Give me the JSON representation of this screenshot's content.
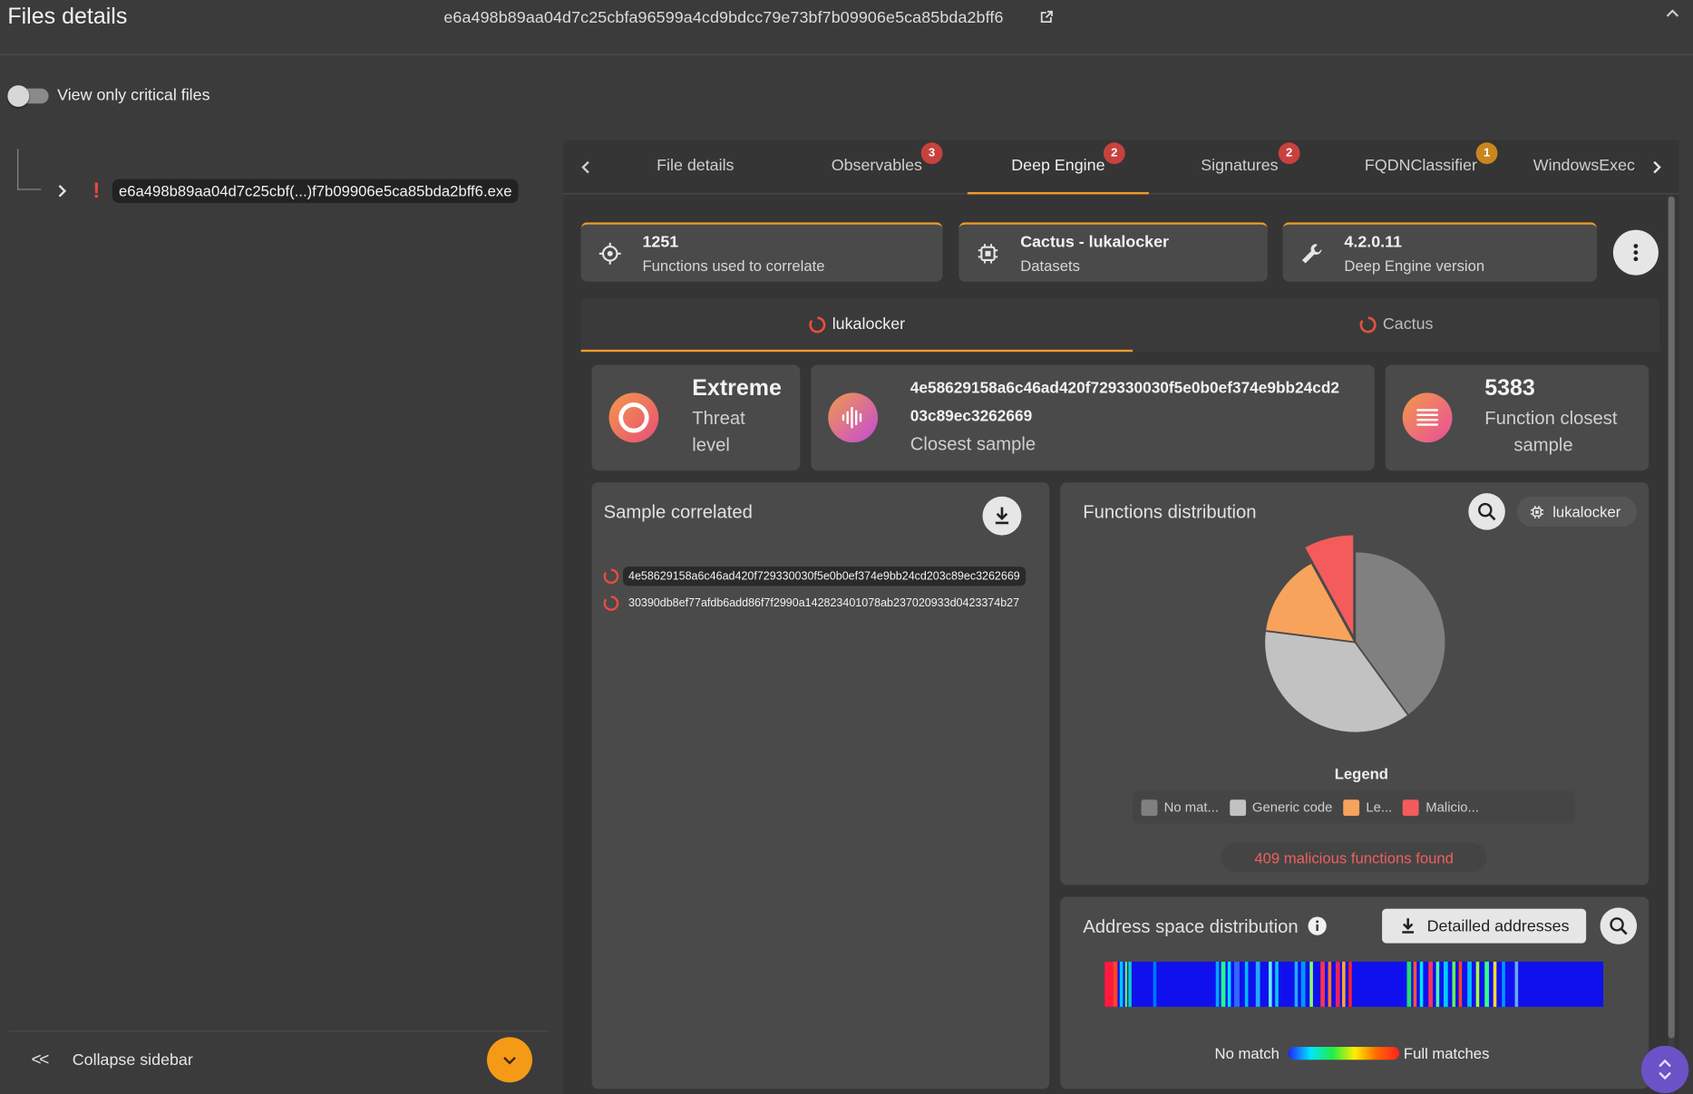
{
  "header": {
    "title": "Files details",
    "file_hash": "e6a498b89aa04d7c25cbfa96599a4cd9bdcc79e73bf7b09906e5ca85bda2bff6"
  },
  "sidebar": {
    "toggle_label": "View only critical files",
    "toggle_on": false,
    "tree_file": "e6a498b89aa04d7c25cbf(...)f7b09906e5ca85bda2bff6.exe",
    "collapse_icon": "<<",
    "collapse_label": "Collapse sidebar"
  },
  "tabs": [
    {
      "label": "File details",
      "badge": ""
    },
    {
      "label": "Observables",
      "badge": "3"
    },
    {
      "label": "Deep Engine",
      "badge": "2",
      "active": true
    },
    {
      "label": "Signatures",
      "badge": "2"
    },
    {
      "label": "FQDNClassifier",
      "badge": "1"
    },
    {
      "label": "WindowsExec",
      "badge": ""
    }
  ],
  "info_cards": [
    {
      "icon": "crosshair-icon",
      "value": "1251",
      "label": "Functions used to correlate"
    },
    {
      "icon": "chip-icon",
      "value": "Cactus - lukalocker",
      "label": "Datasets"
    },
    {
      "icon": "wrench-icon",
      "value": "4.2.0.11",
      "label": "Deep Engine version"
    }
  ],
  "subtabs": [
    {
      "label": "lukalocker",
      "active": true
    },
    {
      "label": "Cactus",
      "active": false
    }
  ],
  "stats": {
    "threat": {
      "value": "Extreme",
      "label_line1": "Threat",
      "label_line2": "level"
    },
    "closest": {
      "line1": "4e58629158a6c46ad420f729330030f5e0b0ef374e9bb24cd2",
      "line2": "03c89ec3262669",
      "label": "Closest sample"
    },
    "functions": {
      "value": "5383",
      "label_line1": "Function closest",
      "label_line2": "sample"
    }
  },
  "sample_correlated": {
    "title": "Sample correlated",
    "items": [
      "4e58629158a6c46ad420f729330030f5e0b0ef374e9bb24cd203c89ec3262669",
      "30390db8ef77afdb6add86f7f2990a142823401078ab237020933d0423374b27"
    ]
  },
  "functions_distribution": {
    "title": "Functions distribution",
    "chip_label": "lukalocker",
    "legend_title": "Legend",
    "legend": [
      {
        "label": "No mat...",
        "color": "#808080"
      },
      {
        "label": "Generic code",
        "color": "#c2c2c2"
      },
      {
        "label": "Le...",
        "color": "#f7a35c"
      },
      {
        "label": "Malicio...",
        "color": "#f45b5b"
      }
    ],
    "malicious_note": "409 malicious functions found"
  },
  "chart_data": {
    "type": "pie",
    "title": "",
    "categories": [
      "No match",
      "Generic code",
      "Legit",
      "Malicious"
    ],
    "values": [
      40,
      37,
      15,
      8
    ],
    "colors": [
      "#808080",
      "#c2c2c2",
      "#f7a35c",
      "#f45b5b"
    ],
    "exploded": "Malicious"
  },
  "address_space": {
    "title": "Address space distribution",
    "button_label": "Detailled addresses",
    "scale_low": "No match",
    "scale_high": "Full matches"
  }
}
